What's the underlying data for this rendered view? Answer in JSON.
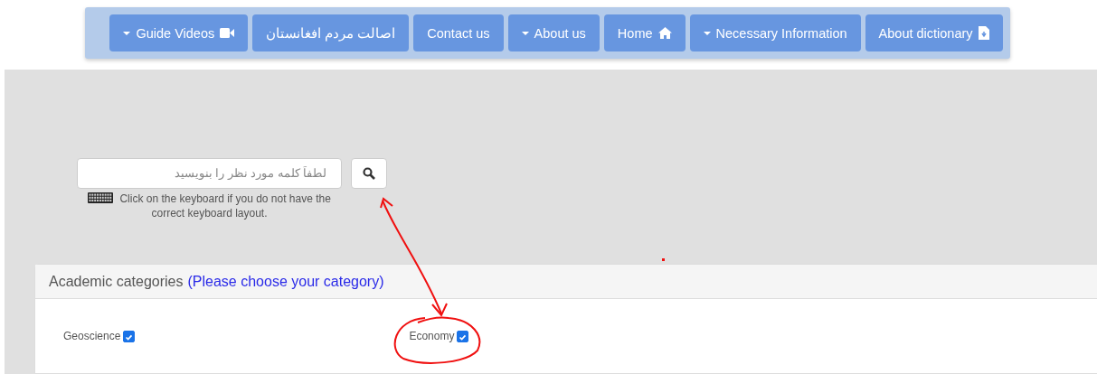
{
  "nav": [
    {
      "label": "Guide Videos",
      "kind": "video"
    },
    {
      "label": "اصالت مردم افغانستان",
      "kind": "plain"
    },
    {
      "label": "Contact us",
      "kind": "plain"
    },
    {
      "label": "About us",
      "kind": "dropdown"
    },
    {
      "label": "Home",
      "kind": "home"
    },
    {
      "label": "Necessary Information",
      "kind": "dropdown"
    },
    {
      "label": "About dictionary",
      "kind": "document"
    }
  ],
  "search": {
    "placeholder": "لطفاً کلمه مورد نظر را بنویسید",
    "hint": "Click on the keyboard if you do not have the correct keyboard layout."
  },
  "categories": {
    "title": "Academic categories",
    "subtitle": "(Please choose your category)",
    "items": [
      {
        "label": "Geoscience",
        "checked": true
      },
      {
        "label": "Economy",
        "checked": true
      }
    ]
  }
}
